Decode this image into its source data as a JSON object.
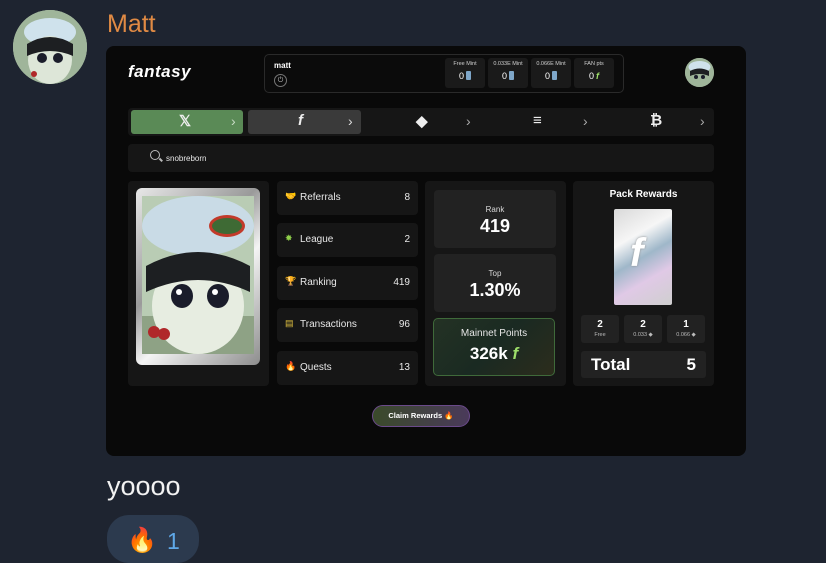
{
  "chat": {
    "sender": "Matt",
    "message": "yoooo",
    "reaction": {
      "emoji": "🔥",
      "count": "1"
    }
  },
  "app": {
    "logo": "fantasy",
    "user": {
      "name": "matt"
    },
    "header_stats": [
      {
        "label": "Free Mint",
        "value": "0"
      },
      {
        "label": "0.033E Mint",
        "value": "0"
      },
      {
        "label": "0.066E Mint",
        "value": "0"
      },
      {
        "label": "FAN pts",
        "value": "0"
      }
    ],
    "tabs": [
      {
        "icon": "𝕏",
        "name": "x"
      },
      {
        "icon": "f",
        "name": "fantasy"
      },
      {
        "icon": "◆",
        "name": "ethereum"
      },
      {
        "icon": "≡",
        "name": "solana"
      },
      {
        "icon": "₿",
        "name": "bitcoin"
      }
    ],
    "search": {
      "value": "snobreborn"
    },
    "stats": [
      {
        "emoji": "🤝",
        "label": "Referrals",
        "value": "8"
      },
      {
        "emoji": "✸",
        "label": "League",
        "value": "2"
      },
      {
        "emoji": "🏆",
        "label": "Ranking",
        "value": "419"
      },
      {
        "emoji": "▤",
        "label": "Transactions",
        "value": "96"
      },
      {
        "emoji": "🔥",
        "label": "Quests",
        "value": "13"
      }
    ],
    "rank": {
      "label": "Rank",
      "value": "419"
    },
    "top": {
      "label": "Top",
      "value": "1.30%"
    },
    "mainnet": {
      "label": "Mainnet Points",
      "value": "326k"
    },
    "pack_rewards": {
      "title": "Pack Rewards",
      "tiers": [
        {
          "value": "2",
          "label": "Free"
        },
        {
          "value": "2",
          "label": "0.033 ◆"
        },
        {
          "value": "1",
          "label": "0.066 ◆"
        }
      ],
      "total_label": "Total",
      "total_value": "5"
    },
    "claim_button": "Claim Rewards 🔥",
    "colors": {
      "accent_green": "#5a8a56",
      "sender": "#e08a44"
    }
  }
}
